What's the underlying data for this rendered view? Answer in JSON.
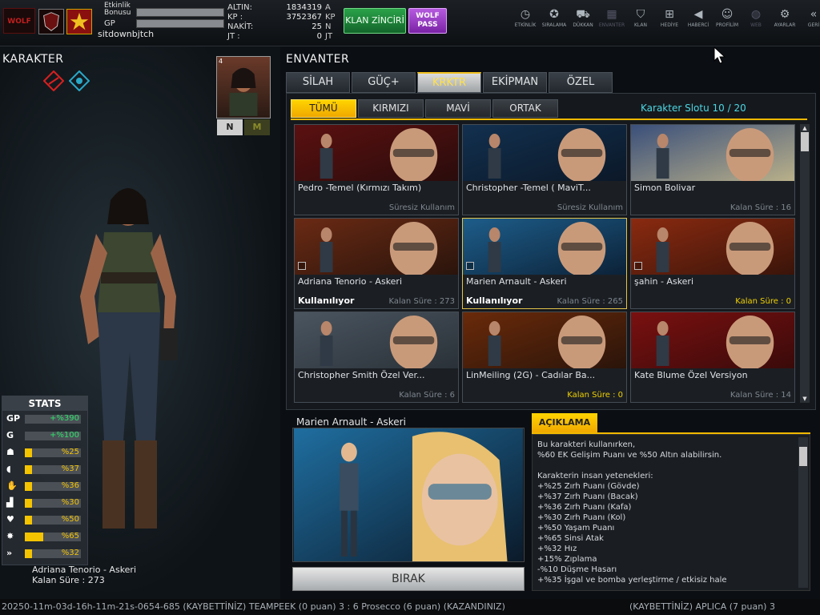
{
  "topbar": {
    "logo_text": "WOLF",
    "etkinlik_label": "Etkinlik\nBonusu",
    "gp_label": "GP",
    "username": "sitdownbjtch",
    "currency": [
      {
        "key": "ALTIN:",
        "value": "1834319",
        "unit": "A"
      },
      {
        "key": "KP :",
        "value": "3752367",
        "unit": "KP"
      },
      {
        "key": "NAKİT:",
        "value": "25",
        "unit": "N"
      },
      {
        "key": "JT :",
        "value": "0",
        "unit": "JT"
      }
    ],
    "klan_button": "KLAN ZİNCİRİ",
    "wolf_button": "WOLF PASS",
    "nav": [
      {
        "label": "ETKİNLİK",
        "icon": "clock-icon"
      },
      {
        "label": "SIRALAMA",
        "icon": "medal-icon"
      },
      {
        "label": "DÜKKAN",
        "icon": "cart-icon"
      },
      {
        "label": "ENVANTER",
        "icon": "inventory-icon"
      },
      {
        "label": "KLAN",
        "icon": "shield-icon"
      },
      {
        "label": "HEDİYE",
        "icon": "gift-icon"
      },
      {
        "label": "HABERCİ",
        "icon": "megaphone-icon"
      },
      {
        "label": "PROFİLİM",
        "icon": "profile-icon"
      },
      {
        "label": "WEB",
        "icon": "globe-icon"
      },
      {
        "label": "AYARLAR",
        "icon": "gear-icon"
      },
      {
        "label": "GERİ",
        "icon": "back-icon"
      }
    ]
  },
  "left": {
    "title": "KARAKTER",
    "card_level": "4",
    "n_label": "N",
    "m_label": "M",
    "stats_title": "STATS",
    "stats": [
      {
        "icon": "GP",
        "value": "+%390",
        "fill": 0,
        "color": "#2ee36a"
      },
      {
        "icon": "G",
        "value": "+%100",
        "fill": 0,
        "color": "#2ee36a"
      },
      {
        "icon": "☗",
        "value": "%25",
        "fill": 0.13,
        "color": "#f5c400"
      },
      {
        "icon": "◖",
        "value": "%37",
        "fill": 0.13,
        "color": "#f5c400"
      },
      {
        "icon": "✋",
        "value": "%36",
        "fill": 0.13,
        "color": "#f5c400"
      },
      {
        "icon": "▟",
        "value": "%30",
        "fill": 0.13,
        "color": "#f5c400"
      },
      {
        "icon": "♥",
        "value": "%50",
        "fill": 0.13,
        "color": "#f5c400"
      },
      {
        "icon": "✸",
        "value": "%65",
        "fill": 0.33,
        "color": "#f5c400"
      },
      {
        "icon": "»",
        "value": "%32",
        "fill": 0.13,
        "color": "#f5c400"
      }
    ],
    "char_name": "Adriana Tenorio - Askeri",
    "char_time": "Kalan Süre : 273"
  },
  "inventory": {
    "title": "ENVANTER",
    "tabs": [
      "SİLAH",
      "GÜÇ+",
      "KRKTR",
      "EKİPMAN",
      "ÖZEL"
    ],
    "active_tab": 2,
    "sub_tabs": [
      "TÜMÜ",
      "KIRMIZI",
      "MAVİ",
      "ORTAK"
    ],
    "active_sub_tab": 0,
    "slot_label": "Karakter Slotu 10 / 20",
    "cards": [
      {
        "name": "Pedro -Temel (Kırmızı Takım)",
        "status": "",
        "duration": "Süresiz Kullanım",
        "yellow": false,
        "check": false,
        "bg1": "#5b1010",
        "bg2": "#2a0c0c",
        "selected": false
      },
      {
        "name": "Christopher -Temel ( MaviT...",
        "status": "",
        "duration": "Süresiz Kullanım",
        "yellow": false,
        "check": false,
        "bg1": "#12304f",
        "bg2": "#0b1828",
        "selected": false
      },
      {
        "name": "Simon Bolivar",
        "status": "",
        "duration": "Kalan Süre : 16",
        "yellow": false,
        "check": false,
        "bg1": "#3a4f7a",
        "bg2": "#b9b08a",
        "selected": false
      },
      {
        "name": "Adriana Tenorio - Askeri",
        "status": "Kullanılıyor",
        "duration": "Kalan Süre : 273",
        "yellow": false,
        "check": true,
        "bg1": "#6a2a14",
        "bg2": "#2a140c",
        "selected": false
      },
      {
        "name": "Marien Arnault - Askeri",
        "status": "Kullanılıyor",
        "duration": "Kalan Süre : 265",
        "yellow": false,
        "check": true,
        "bg1": "#1d5d8a",
        "bg2": "#0c2238",
        "selected": true
      },
      {
        "name": "şahin - Askeri",
        "status": "",
        "duration": "Kalan Süre : 0",
        "yellow": true,
        "check": true,
        "bg1": "#8a2a10",
        "bg2": "#3a140a",
        "selected": false
      },
      {
        "name": "Christopher Smith Özel Ver...",
        "status": "",
        "duration": "Kalan Süre : 6",
        "yellow": false,
        "check": false,
        "bg1": "#4a5560",
        "bg2": "#2a3138",
        "selected": false
      },
      {
        "name": "LinMeiling (2G) - Cadılar Ba...",
        "status": "",
        "duration": "Kalan Süre : 0",
        "yellow": true,
        "check": false,
        "bg1": "#6a2a0a",
        "bg2": "#2a140a",
        "selected": false
      },
      {
        "name": "Kate Blume Özel Versiyon",
        "status": "",
        "duration": "Kalan Süre : 14",
        "yellow": false,
        "check": false,
        "bg1": "#7a1010",
        "bg2": "#3a0a0a",
        "selected": false
      }
    ]
  },
  "detail": {
    "name": "Marien Arnault - Askeri",
    "birak": "BIRAK",
    "aciklama_title": "AÇIKLAMA",
    "aciklama_text": "Bu karakteri kullanırken,\n%60 EK Gelişim Puanı ve %50 Altın alabilirsin.\n\nKarakterin insan yetenekleri:\n+%25 Zırh Puanı (Gövde)\n+%37 Zırh Puanı (Bacak)\n+%36 Zırh Puanı (Kafa)\n+%30 Zırh Puanı (Kol)\n+%50 Yaşam Puanı\n+%65 Sinsi Atak\n+%32 Hız\n+15% Zıplama\n-%10 Düşme Hasarı\n+%35 İşgal ve bomba yerleştirme / etkisiz hale"
  },
  "ticker": {
    "left": "20250-11m-03d-16h-11m-21s-0654-685   (KAYBETTİNİZ) TEAMPEEK (0 puan) 3 : 6 Prosecco (6 puan) (KAZANDINIZ)",
    "right": "(KAYBETTİNİZ) APLICA (7 puan) 3"
  },
  "colors": {
    "accent_yellow": "#f0b800",
    "slot_cyan": "#4cd6e4",
    "status_green": "#2ee36a"
  }
}
